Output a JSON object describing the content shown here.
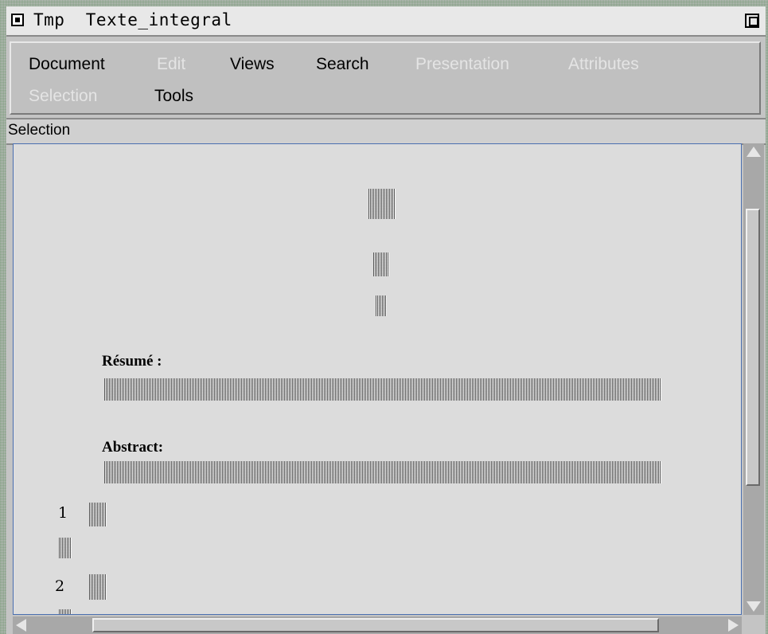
{
  "window": {
    "title": "Tmp  Texte_integral",
    "window_menu_icon": "window-menu-icon",
    "maximize_icon": "maximize-icon"
  },
  "menu": {
    "items": [
      {
        "label": "Document",
        "enabled": true
      },
      {
        "label": "Edit",
        "enabled": false
      },
      {
        "label": "Views",
        "enabled": true
      },
      {
        "label": "Search",
        "enabled": true
      },
      {
        "label": "Presentation",
        "enabled": false
      },
      {
        "label": "Attributes",
        "enabled": false
      },
      {
        "label": "Selection",
        "enabled": false
      },
      {
        "label": "Tools",
        "enabled": true
      }
    ]
  },
  "status": {
    "label": "Selection"
  },
  "document": {
    "resume_heading": "Résumé :",
    "abstract_heading": "Abstract:",
    "sections": [
      {
        "number": "1"
      },
      {
        "number": "2"
      }
    ]
  },
  "colors": {
    "disabled_menu": "#e4e4e4",
    "view_border": "#4a6fb0"
  }
}
